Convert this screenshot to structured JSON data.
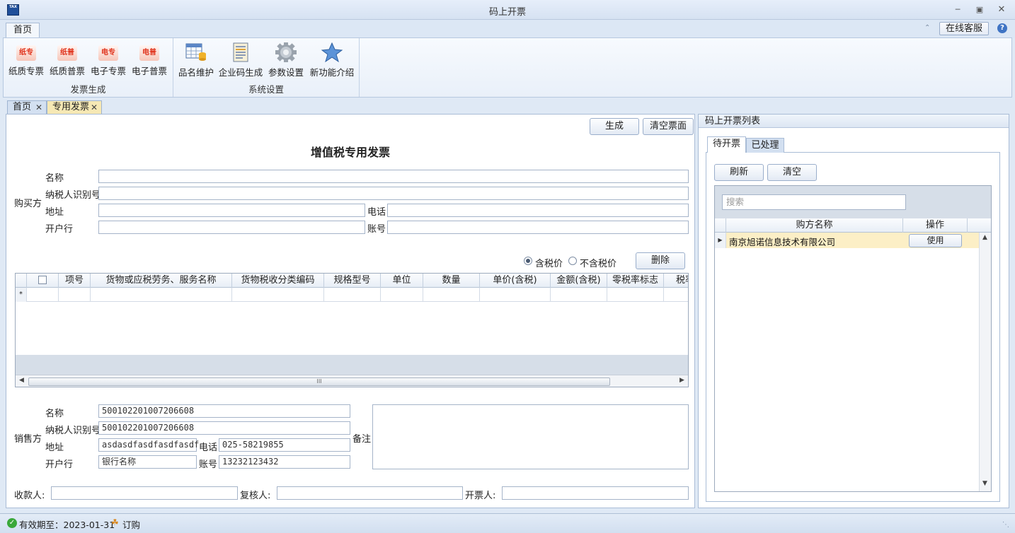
{
  "window": {
    "title": "码上开票",
    "app_icon_text": "TAX"
  },
  "ribbon": {
    "tab_home": "首页",
    "online_service": "在线客服",
    "groups": [
      {
        "label": "发票生成",
        "buttons": [
          {
            "label": "纸质专票",
            "icon_text": "纸专",
            "icon": "paper-special-invoice-icon"
          },
          {
            "label": "纸质普票",
            "icon_text": "纸普",
            "icon": "paper-normal-invoice-icon"
          },
          {
            "label": "电子专票",
            "icon_text": "电专",
            "icon": "e-special-invoice-icon"
          },
          {
            "label": "电子普票",
            "icon_text": "电普",
            "icon": "e-normal-invoice-icon"
          }
        ]
      },
      {
        "label": "系统设置",
        "buttons": [
          {
            "label": "品名维护",
            "icon": "table-database-icon"
          },
          {
            "label": "企业码生成",
            "icon": "document-icon"
          },
          {
            "label": "参数设置",
            "icon": "gear-icon"
          },
          {
            "label": "新功能介绍",
            "icon": "star-icon"
          }
        ]
      }
    ]
  },
  "doc_tabs": [
    {
      "label": "首页"
    },
    {
      "label": "专用发票"
    }
  ],
  "form": {
    "generate_btn": "生成",
    "clear_btn": "清空票面",
    "title": "增值税专用发票",
    "buyer": {
      "section": "购买方",
      "name_label": "名称",
      "taxid_label": "纳税人识别号",
      "address_label": "地址",
      "phone_label": "电话",
      "bank_label": "开户行",
      "account_label": "账号",
      "name": "",
      "taxid": "",
      "address": "",
      "phone": "",
      "bank": "",
      "account": ""
    },
    "price_mode": {
      "incl_label": "含税价",
      "excl_label": "不含税价",
      "selected": "incl"
    },
    "delete_btn": "删除",
    "grid_columns": [
      "项号",
      "货物或应税劳务、服务名称",
      "货物税收分类编码",
      "规格型号",
      "单位",
      "数量",
      "单价(含税)",
      "金额(含税)",
      "零税率标志",
      "税率"
    ],
    "new_row_marker": "*",
    "scroll_grip": "III",
    "seller": {
      "section": "销售方",
      "name_label": "名称",
      "taxid_label": "纳税人识别号",
      "address_label": "地址",
      "phone_label": "电话",
      "bank_label": "开户行",
      "account_label": "账号",
      "name": "500102201007206608",
      "taxid": "500102201007206608",
      "address": "asdasdfasdfasdfasdf",
      "phone": "025-58219855",
      "bank": "银行名称",
      "account": "13232123432"
    },
    "remark_label": "备注",
    "payee_label": "收款人:",
    "reviewer_label": "复核人:",
    "drawer_label": "开票人:"
  },
  "right_panel": {
    "title": "码上开票列表",
    "tab_pending": "待开票",
    "tab_processed": "已处理",
    "refresh_btn": "刷新",
    "clear_btn": "清空",
    "search_placeholder": "搜索",
    "col_buyer": "购方名称",
    "col_action": "操作",
    "rows": [
      {
        "buyer": "南京旭诺信息技术有限公司",
        "action": "使用"
      }
    ]
  },
  "status": {
    "validity": "有效期至：2023-01-31",
    "order": "订购"
  }
}
